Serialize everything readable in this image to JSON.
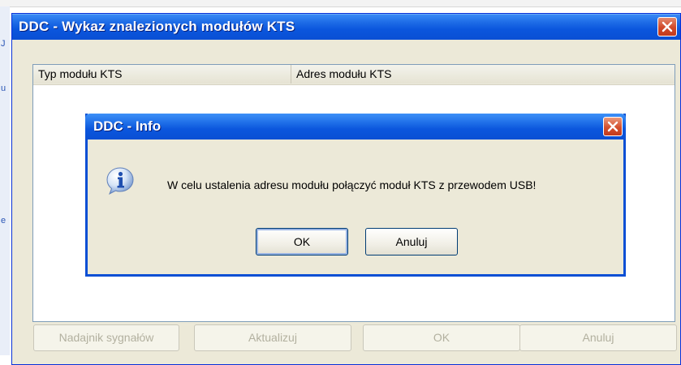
{
  "background": {
    "left_glyphs": [
      "J",
      "u",
      "e"
    ]
  },
  "main_window": {
    "title": "DDC - Wykaz znalezionych modułów KTS",
    "close_icon": "close-icon",
    "list": {
      "columns": [
        "Typ modułu KTS",
        "Adres modułu KTS"
      ],
      "rows": []
    },
    "buttons": {
      "signal": "Nadajnik sygnałów",
      "refresh": "Aktualizuj",
      "ok": "OK",
      "cancel": "Anuluj"
    }
  },
  "info_dialog": {
    "title": "DDC - Info",
    "icon": "info-icon",
    "message": "W celu ustalenia adresu modułu połączyć moduł KTS z przewodem USB!",
    "ok_label": "OK",
    "cancel_label": "Anuluj"
  },
  "colors": {
    "titlebar": "#0a4fd4",
    "close_button": "#d0492a",
    "window_face": "#ece9d8"
  }
}
